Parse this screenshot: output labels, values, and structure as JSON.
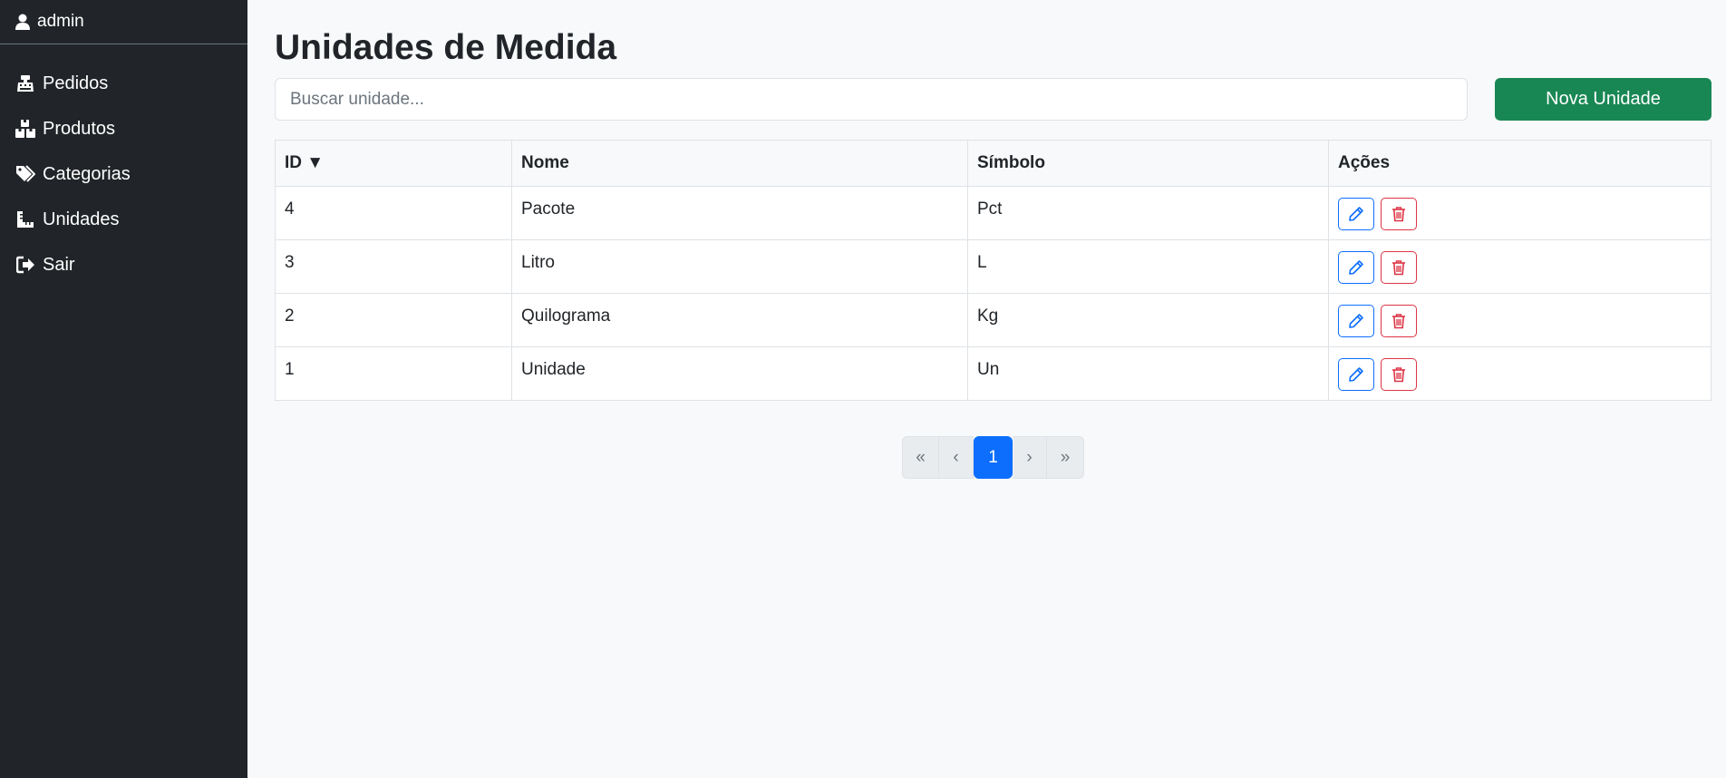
{
  "sidebar": {
    "user": "admin",
    "items": [
      {
        "label": "Pedidos",
        "icon": "cash-register-icon"
      },
      {
        "label": "Produtos",
        "icon": "boxes-icon"
      },
      {
        "label": "Categorias",
        "icon": "tags-icon"
      },
      {
        "label": "Unidades",
        "icon": "ruler-icon"
      },
      {
        "label": "Sair",
        "icon": "sign-out-icon"
      }
    ]
  },
  "main": {
    "title": "Unidades de Medida",
    "search_placeholder": "Buscar unidade...",
    "new_button": "Nova Unidade"
  },
  "table": {
    "headers": [
      "ID ▼",
      "Nome",
      "Símbolo",
      "Ações"
    ],
    "rows": [
      {
        "id": "4",
        "nome": "Pacote",
        "simbolo": "Pct"
      },
      {
        "id": "3",
        "nome": "Litro",
        "simbolo": "L"
      },
      {
        "id": "2",
        "nome": "Quilograma",
        "simbolo": "Kg"
      },
      {
        "id": "1",
        "nome": "Unidade",
        "simbolo": "Un"
      }
    ]
  },
  "pagination": {
    "first": "«",
    "prev": "‹",
    "current": "1",
    "next": "›",
    "last": "»"
  },
  "colors": {
    "sidebar": "#212529",
    "primary": "#0d6efd",
    "success": "#198754",
    "danger": "#dc3545"
  }
}
